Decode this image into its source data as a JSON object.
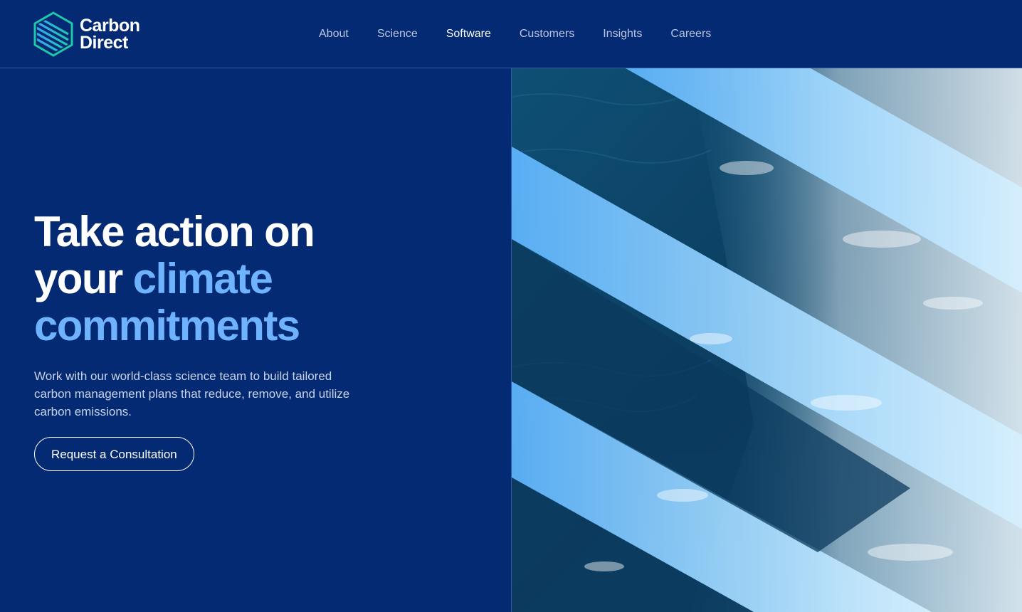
{
  "brand": {
    "line1": "Carbon",
    "line2": "Direct",
    "logo_icon": "hexagon-stripes-icon",
    "colors": {
      "logo_teal": "#1fc8a9",
      "logo_blue": "#3aa0ff"
    }
  },
  "nav": {
    "items": [
      {
        "label": "About",
        "active": false
      },
      {
        "label": "Science",
        "active": false
      },
      {
        "label": "Software",
        "active": true
      },
      {
        "label": "Customers",
        "active": false
      },
      {
        "label": "Insights",
        "active": false
      },
      {
        "label": "Careers",
        "active": false
      }
    ]
  },
  "hero": {
    "headline_line1": "Take action on",
    "headline_line2_plain": "your ",
    "headline_line2_accent": "climate",
    "headline_line3_accent": "commitments",
    "subtext": "Work with our world-class science team to build tailored carbon management plans that reduce, remove, and utilize carbon emissions.",
    "cta_label": "Request a Consultation"
  },
  "colors": {
    "background": "#032a72",
    "accent": "#6fb3ff",
    "text": "#ffffff",
    "muted_text": "#c8d3ea"
  }
}
